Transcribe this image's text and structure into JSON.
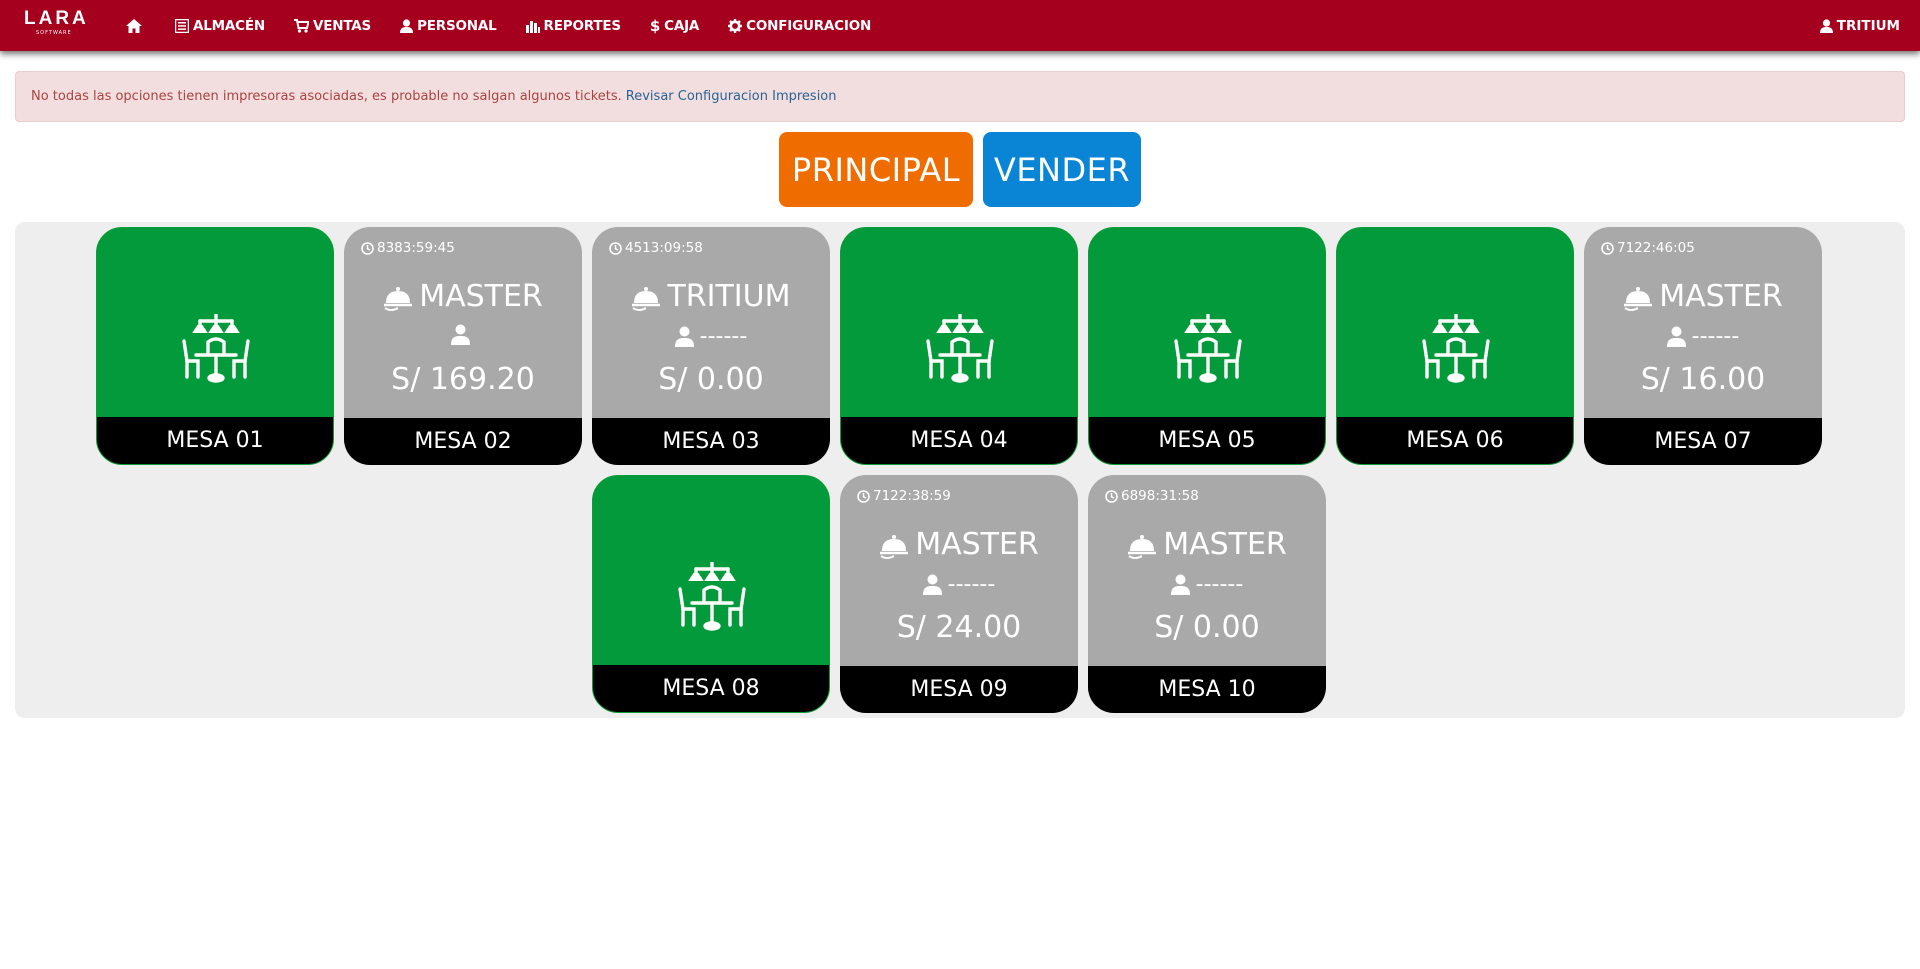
{
  "nav": {
    "brand": "LARA",
    "brand_sub": "SOFTWARE",
    "items": [
      {
        "label": "",
        "icon": "home-icon"
      },
      {
        "label": "ALMACÉN",
        "icon": "list-icon"
      },
      {
        "label": "VENTAS",
        "icon": "cart-icon"
      },
      {
        "label": "PERSONAL",
        "icon": "user-icon"
      },
      {
        "label": "REPORTES",
        "icon": "bar-chart-icon"
      },
      {
        "label": "CAJA",
        "icon": "dollar-icon"
      },
      {
        "label": "CONFIGURACION",
        "icon": "gear-icon"
      }
    ],
    "user": "TRITIUM"
  },
  "alert": {
    "message": "No todas las opciones tienen impresoras asociadas, es probable no salgan algunos tickets.",
    "link": "Revisar Configuracion Impresion"
  },
  "buttons": {
    "principal": "PRINCIPAL",
    "vender": "VENDER"
  },
  "colors": {
    "navbar": "#a5001e",
    "free_table": "#029a3b",
    "busy_table": "#a9a9a9",
    "principal": "#ef6c00",
    "vender": "#0a84d4"
  },
  "mesas": [
    {
      "name": "MESA 01",
      "status": "free"
    },
    {
      "name": "MESA 02",
      "status": "busy",
      "time": "8383:59:45",
      "waiter": "MASTER",
      "client": "",
      "total": "S/ 169.20"
    },
    {
      "name": "MESA 03",
      "status": "busy",
      "time": "4513:09:58",
      "waiter": "TRITIUM",
      "client": "------",
      "total": "S/ 0.00"
    },
    {
      "name": "MESA 04",
      "status": "free"
    },
    {
      "name": "MESA 05",
      "status": "free"
    },
    {
      "name": "MESA 06",
      "status": "free"
    },
    {
      "name": "MESA 07",
      "status": "busy",
      "time": "7122:46:05",
      "waiter": "MASTER",
      "client": "------",
      "total": "S/ 16.00"
    },
    {
      "name": "MESA 08",
      "status": "free"
    },
    {
      "name": "MESA 09",
      "status": "busy",
      "time": "7122:38:59",
      "waiter": "MASTER",
      "client": "------",
      "total": "S/ 24.00"
    },
    {
      "name": "MESA 10",
      "status": "busy",
      "time": "6898:31:58",
      "waiter": "MASTER",
      "client": "------",
      "total": "S/ 0.00"
    }
  ]
}
